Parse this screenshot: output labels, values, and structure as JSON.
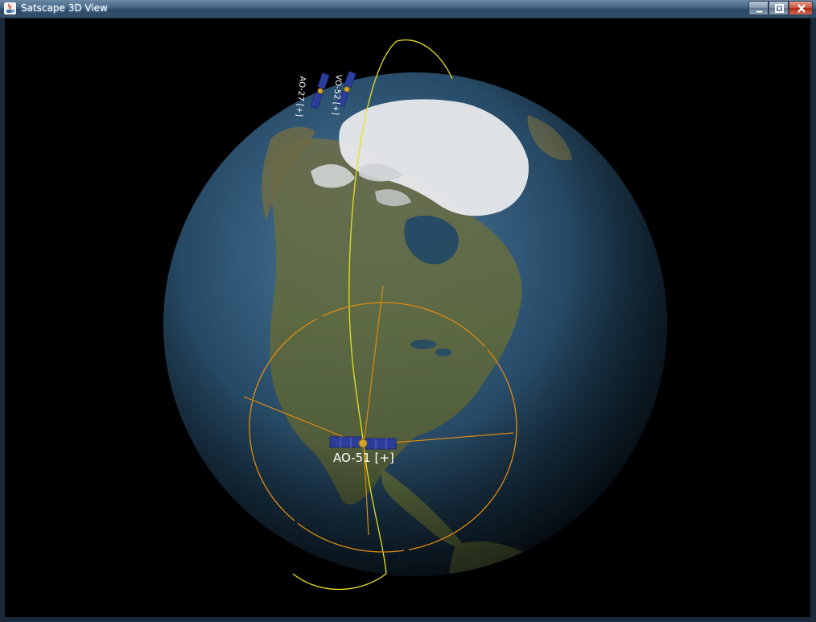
{
  "window": {
    "title": "Satscape 3D View",
    "icon": "java-cup-icon"
  },
  "controls": {
    "minimize_icon": "minimize-icon",
    "maximize_icon": "restore-icon",
    "close_icon": "close-icon"
  },
  "scene": {
    "background_color": "#000000",
    "globe_ocean_color": "#2c5270",
    "orbit_color": "#e8e020",
    "footprint_color": "#e08a10",
    "satellite_panel_color": "#2c3e9a"
  },
  "satellites": [
    {
      "label": "AO-51 [+]",
      "selected": true
    },
    {
      "label": "VO-52 [+]",
      "selected": false
    },
    {
      "label": "AO-27 [+]",
      "selected": false
    }
  ]
}
